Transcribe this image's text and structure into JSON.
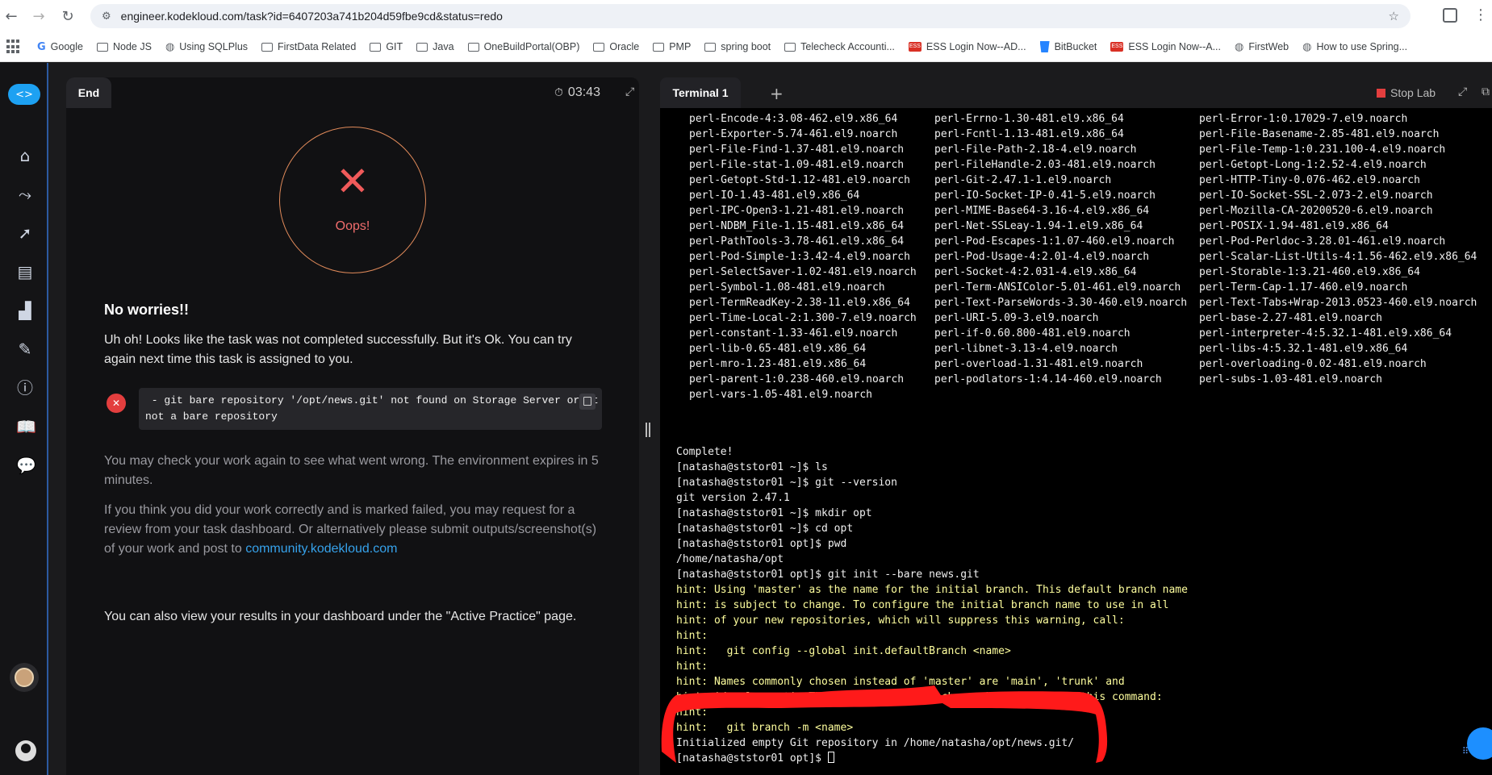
{
  "browser": {
    "url": "engineer.kodekloud.com/task?id=6407203a741b204d59fbe9cd&status=redo",
    "bookmarks": [
      {
        "label": "Google",
        "icon": "google-icon"
      },
      {
        "label": "Node JS",
        "icon": "folder-icon"
      },
      {
        "label": "Using SQLPlus",
        "icon": "globe-icon"
      },
      {
        "label": "FirstData Related",
        "icon": "folder-icon"
      },
      {
        "label": "GIT",
        "icon": "folder-icon"
      },
      {
        "label": "Java",
        "icon": "folder-icon"
      },
      {
        "label": "OneBuildPortal(OBP)",
        "icon": "folder-icon"
      },
      {
        "label": "Oracle",
        "icon": "folder-icon"
      },
      {
        "label": "PMP",
        "icon": "folder-icon"
      },
      {
        "label": "spring boot",
        "icon": "folder-icon"
      },
      {
        "label": "Telecheck Accounti...",
        "icon": "folder-icon"
      },
      {
        "label": "ESS Login Now--AD...",
        "icon": "ess-icon"
      },
      {
        "label": "BitBucket",
        "icon": "bitbucket-icon"
      },
      {
        "label": "ESS  Login Now--A...",
        "icon": "ess-icon"
      },
      {
        "label": "FirstWeb",
        "icon": "globe-icon"
      },
      {
        "label": "How to use Spring...",
        "icon": "globe-icon"
      }
    ]
  },
  "task": {
    "tab_label": "End",
    "timer": "03:43",
    "oops_label": "Oops!",
    "heading": "No worries!!",
    "message": "Uh oh! Looks like the task was not completed successfully. But it's Ok. You can try again next time this task is assigned to you.",
    "error_text": " - git bare repository '/opt/news.git' not found on Storage Server or it\nnot a bare repository",
    "check_text": "You may check your work again to see what went wrong. The environment expires in 5 minutes.",
    "review_text": "If you think you did your work correctly and is marked failed, you may request for a review from your task dashboard. Or alternatively please submit outputs/screenshot(s) of your work and post to ",
    "community_link": "community.kodekloud.com",
    "dashboard_text": "You can also view your results in your dashboard under the \"Active Practice\" page."
  },
  "terminal": {
    "tab_label": "Terminal 1",
    "stop_label": "Stop Lab",
    "packages": [
      [
        "perl-Encode-4:3.08-462.el9.x86_64",
        "perl-Errno-1.30-481.el9.x86_64",
        "perl-Error-1:0.17029-7.el9.noarch"
      ],
      [
        "perl-Exporter-5.74-461.el9.noarch",
        "perl-Fcntl-1.13-481.el9.x86_64",
        "perl-File-Basename-2.85-481.el9.noarch"
      ],
      [
        "perl-File-Find-1.37-481.el9.noarch",
        "perl-File-Path-2.18-4.el9.noarch",
        "perl-File-Temp-1:0.231.100-4.el9.noarch"
      ],
      [
        "perl-File-stat-1.09-481.el9.noarch",
        "perl-FileHandle-2.03-481.el9.noarch",
        "perl-Getopt-Long-1:2.52-4.el9.noarch"
      ],
      [
        "perl-Getopt-Std-1.12-481.el9.noarch",
        "perl-Git-2.47.1-1.el9.noarch",
        "perl-HTTP-Tiny-0.076-462.el9.noarch"
      ],
      [
        "perl-IO-1.43-481.el9.x86_64",
        "perl-IO-Socket-IP-0.41-5.el9.noarch",
        "perl-IO-Socket-SSL-2.073-2.el9.noarch"
      ],
      [
        "perl-IPC-Open3-1.21-481.el9.noarch",
        "perl-MIME-Base64-3.16-4.el9.x86_64",
        "perl-Mozilla-CA-20200520-6.el9.noarch"
      ],
      [
        "perl-NDBM_File-1.15-481.el9.x86_64",
        "perl-Net-SSLeay-1.94-1.el9.x86_64",
        "perl-POSIX-1.94-481.el9.x86_64"
      ],
      [
        "perl-PathTools-3.78-461.el9.x86_64",
        "perl-Pod-Escapes-1:1.07-460.el9.noarch",
        "perl-Pod-Perldoc-3.28.01-461.el9.noarch"
      ],
      [
        "perl-Pod-Simple-1:3.42-4.el9.noarch",
        "perl-Pod-Usage-4:2.01-4.el9.noarch",
        "perl-Scalar-List-Utils-4:1.56-462.el9.x86_64"
      ],
      [
        "perl-SelectSaver-1.02-481.el9.noarch",
        "perl-Socket-4:2.031-4.el9.x86_64",
        "perl-Storable-1:3.21-460.el9.x86_64"
      ],
      [
        "perl-Symbol-1.08-481.el9.noarch",
        "perl-Term-ANSIColor-5.01-461.el9.noarch",
        "perl-Term-Cap-1.17-460.el9.noarch"
      ],
      [
        "perl-TermReadKey-2.38-11.el9.x86_64",
        "perl-Text-ParseWords-3.30-460.el9.noarch",
        "perl-Text-Tabs+Wrap-2013.0523-460.el9.noarch"
      ],
      [
        "perl-Time-Local-2:1.300-7.el9.noarch",
        "perl-URI-5.09-3.el9.noarch",
        "perl-base-2.27-481.el9.noarch"
      ],
      [
        "perl-constant-1.33-461.el9.noarch",
        "perl-if-0.60.800-481.el9.noarch",
        "perl-interpreter-4:5.32.1-481.el9.x86_64"
      ],
      [
        "perl-lib-0.65-481.el9.x86_64",
        "perl-libnet-3.13-4.el9.noarch",
        "perl-libs-4:5.32.1-481.el9.x86_64"
      ],
      [
        "perl-mro-1.23-481.el9.x86_64",
        "perl-overload-1.31-481.el9.noarch",
        "perl-overloading-0.02-481.el9.noarch"
      ],
      [
        "perl-parent-1:0.238-460.el9.noarch",
        "perl-podlators-1:4.14-460.el9.noarch",
        "perl-subs-1.03-481.el9.noarch"
      ],
      [
        "perl-vars-1.05-481.el9.noarch",
        "",
        ""
      ]
    ],
    "lines": [
      {
        "text": "",
        "hint": false
      },
      {
        "text": "Complete!",
        "hint": false
      },
      {
        "text": "[natasha@ststor01 ~]$ ls",
        "hint": false
      },
      {
        "text": "[natasha@ststor01 ~]$ git --version",
        "hint": false
      },
      {
        "text": "git version 2.47.1",
        "hint": false
      },
      {
        "text": "[natasha@ststor01 ~]$ mkdir opt",
        "hint": false
      },
      {
        "text": "[natasha@ststor01 ~]$ cd opt",
        "hint": false
      },
      {
        "text": "[natasha@ststor01 opt]$ pwd",
        "hint": false
      },
      {
        "text": "/home/natasha/opt",
        "hint": false
      },
      {
        "text": "[natasha@ststor01 opt]$ git init --bare news.git",
        "hint": false
      },
      {
        "text": "hint: Using 'master' as the name for the initial branch. This default branch name",
        "hint": true
      },
      {
        "text": "hint: is subject to change. To configure the initial branch name to use in all",
        "hint": true
      },
      {
        "text": "hint: of your new repositories, which will suppress this warning, call:",
        "hint": true
      },
      {
        "text": "hint:",
        "hint": true
      },
      {
        "text": "hint:   git config --global init.defaultBranch <name>",
        "hint": true
      },
      {
        "text": "hint:",
        "hint": true
      },
      {
        "text": "hint: Names commonly chosen instead of 'master' are 'main', 'trunk' and",
        "hint": true
      },
      {
        "text": "hint: 'development'. The just-created branch can be renamed via this command:",
        "hint": true
      },
      {
        "text": "hint:",
        "hint": true
      },
      {
        "text": "hint:   git branch -m <name>",
        "hint": true
      },
      {
        "text": "Initialized empty Git repository in /home/natasha/opt/news.git/",
        "hint": false
      },
      {
        "text": "[natasha@ststor01 opt]$ ",
        "hint": false,
        "cursor": true
      }
    ]
  },
  "colors": {
    "accent": "#1da1f2",
    "error": "#e33e3e",
    "hint_text": "#ffff9e",
    "annotation": "#ff1a1a"
  }
}
